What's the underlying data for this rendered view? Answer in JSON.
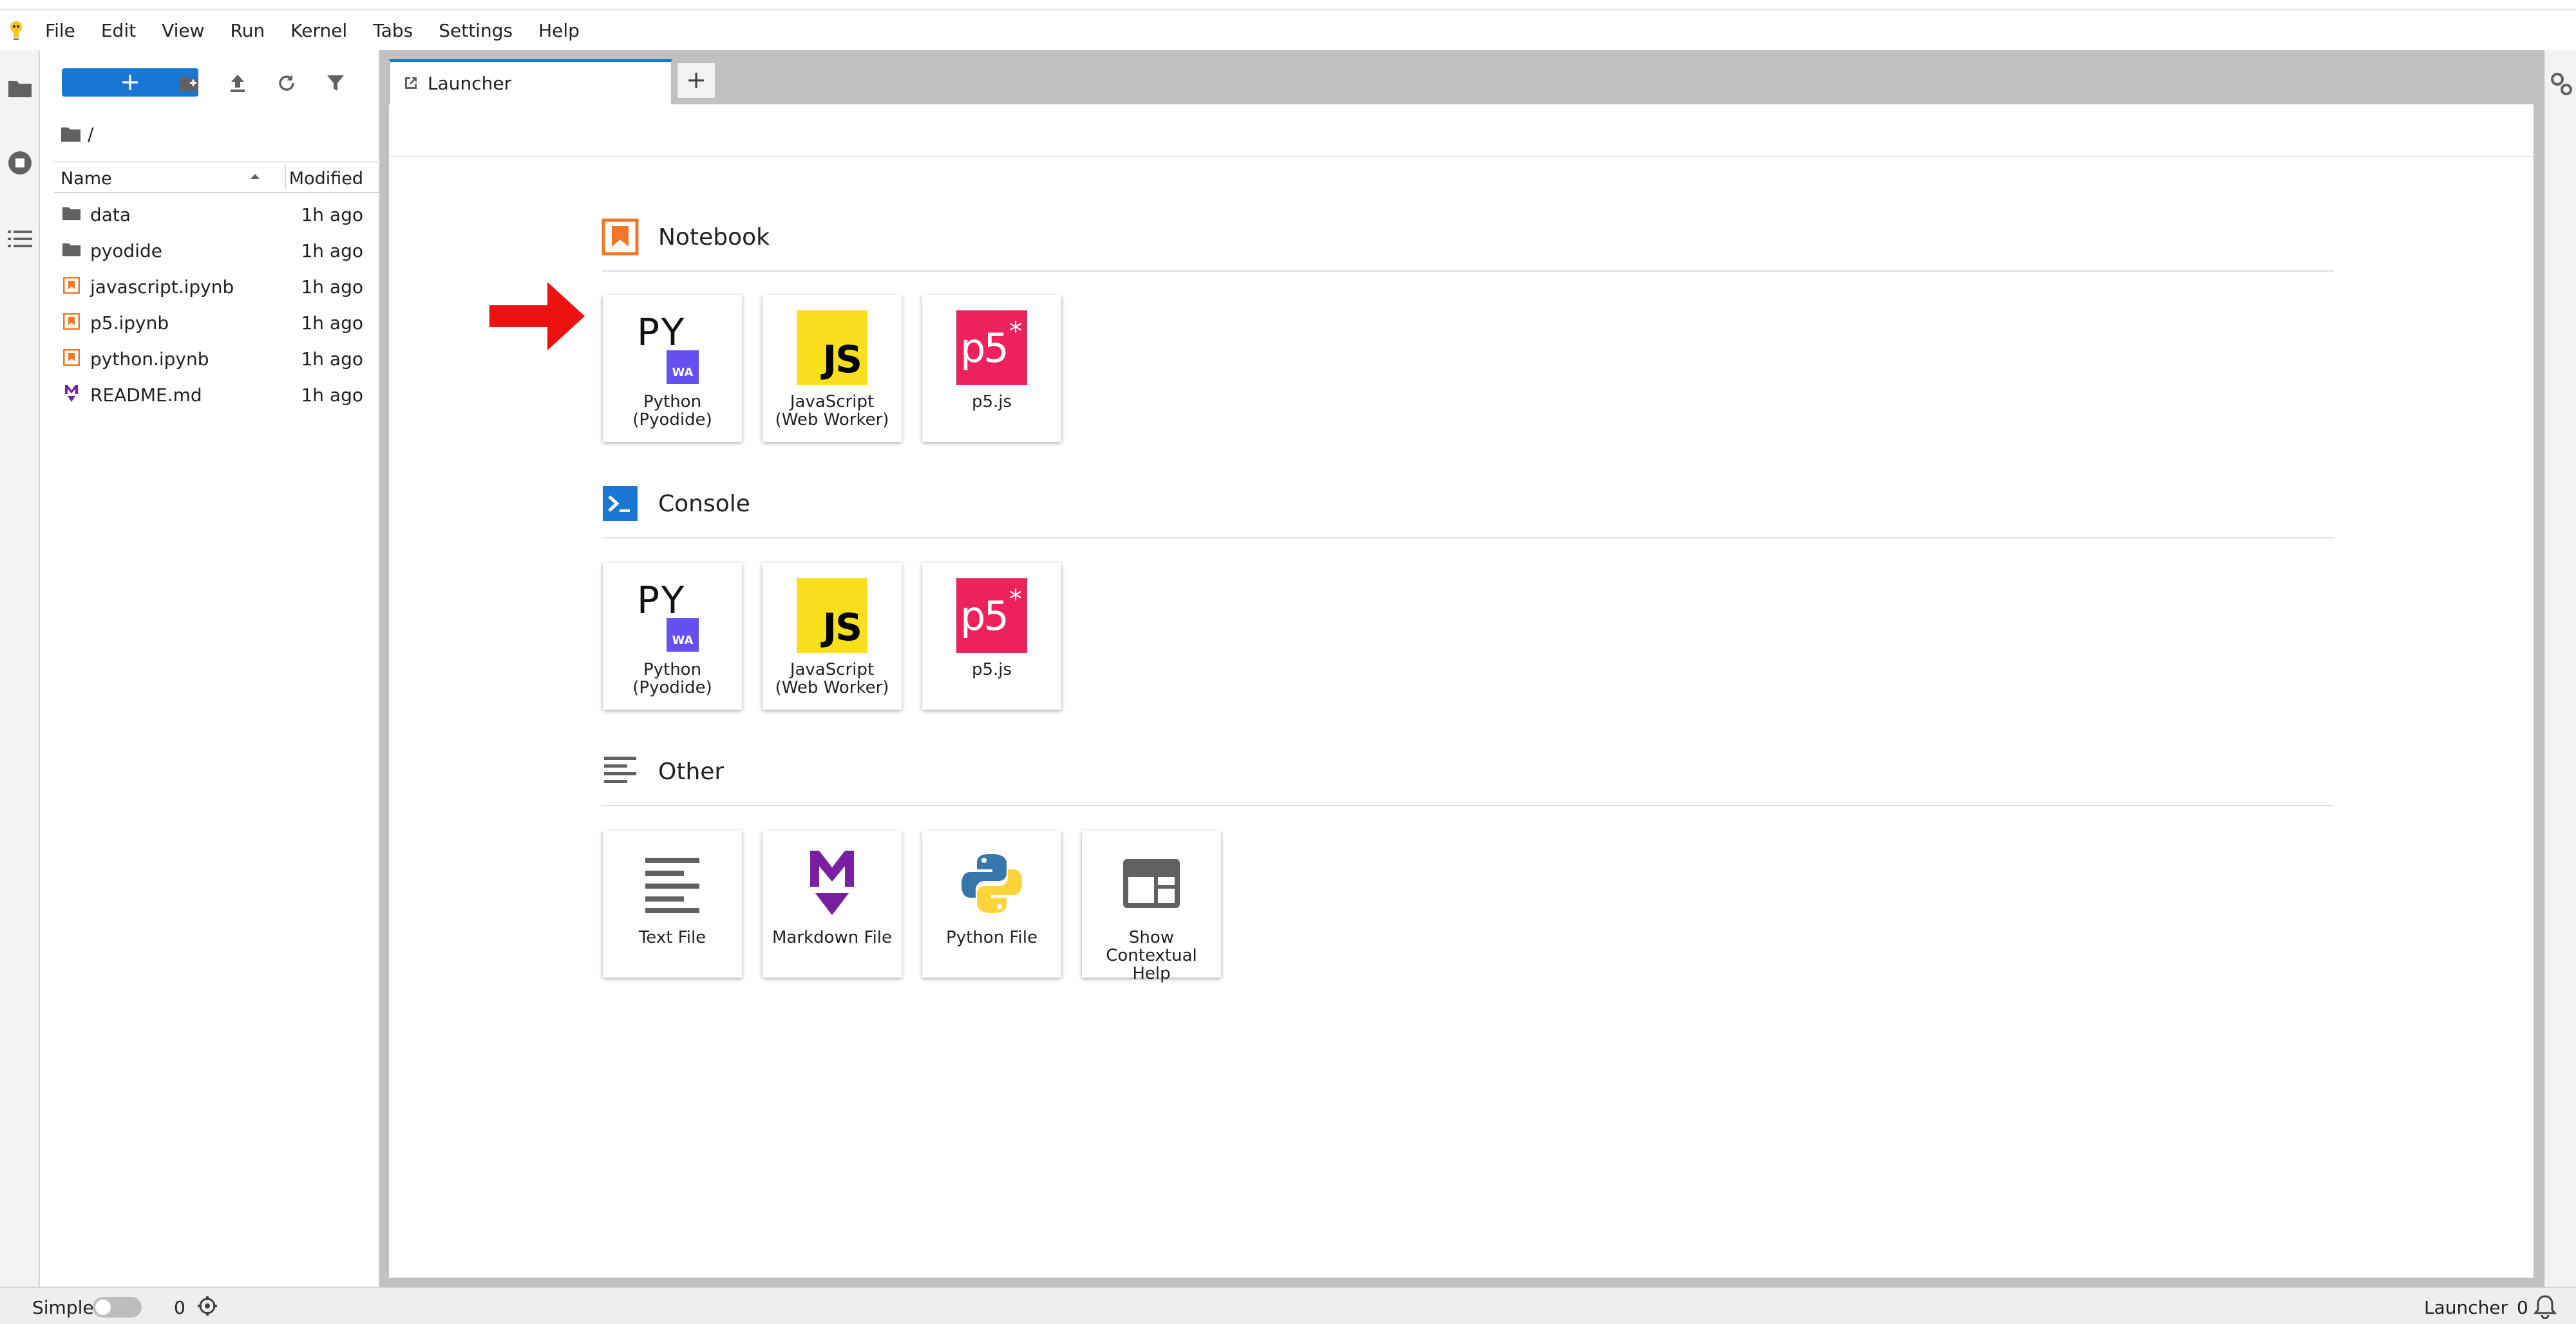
{
  "menu": {
    "items": [
      "File",
      "Edit",
      "View",
      "Run",
      "Kernel",
      "Tabs",
      "Settings",
      "Help"
    ]
  },
  "file_browser": {
    "new_button_label": "+",
    "path": "/",
    "columns": {
      "name": "Name",
      "modified": "Modified"
    },
    "files": [
      {
        "name": "data",
        "modified": "1h ago",
        "icon": "folder-icon"
      },
      {
        "name": "pyodide",
        "modified": "1h ago",
        "icon": "folder-icon"
      },
      {
        "name": "javascript.ipynb",
        "modified": "1h ago",
        "icon": "notebook-icon"
      },
      {
        "name": "p5.ipynb",
        "modified": "1h ago",
        "icon": "notebook-icon"
      },
      {
        "name": "python.ipynb",
        "modified": "1h ago",
        "icon": "notebook-icon"
      },
      {
        "name": "README.md",
        "modified": "1h ago",
        "icon": "markdown-icon"
      }
    ]
  },
  "tabs": {
    "launcher_label": "Launcher",
    "add_label": "+"
  },
  "launcher": {
    "notebook": {
      "title": "Notebook",
      "cards": [
        "Python (Pyodide)",
        "JavaScript (Web Worker)",
        "p5.js"
      ]
    },
    "console": {
      "title": "Console",
      "cards": [
        "Python (Pyodide)",
        "JavaScript (Web Worker)",
        "p5.js"
      ]
    },
    "other": {
      "title": "Other",
      "cards": [
        "Text File",
        "Markdown File",
        "Python File",
        "Show Contextual Help"
      ]
    },
    "logo_text": {
      "py": "PY",
      "wa": "WA",
      "js": "JS",
      "p5": "p5",
      "p5_star": "*",
      "markdown": "M"
    }
  },
  "status": {
    "mode_label": "Simple",
    "kernel_count": "0",
    "current_tab": "Launcher",
    "notification_count": "0"
  },
  "colors": {
    "accent": "#1976d2",
    "notebook_orange": "#f37626",
    "js_yellow": "#f7df1e",
    "p5_pink": "#ed225d",
    "wasm_purple": "#654ff0",
    "markdown_purple": "#7b1fa2",
    "annotation_red": "#ee1111"
  }
}
